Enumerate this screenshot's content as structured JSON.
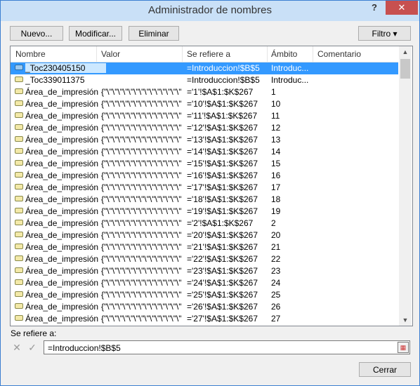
{
  "window": {
    "title": "Administrador de nombres",
    "help": "?",
    "close": "✕"
  },
  "toolbar": {
    "new_label": "Nuevo...",
    "edit_label": "Modificar...",
    "delete_label": "Eliminar",
    "filter_label": "Filtro ▾"
  },
  "columns": {
    "name": "Nombre",
    "value": "Valor",
    "refers_to": "Se refiere a",
    "scope": "Ámbito",
    "comment": "Comentario"
  },
  "rows": [
    {
      "name": "_Toc230405150",
      "value": "",
      "ref": "=Introduccion!$B$5",
      "scope": "Introduc...",
      "comment": "",
      "icon": "blue",
      "selected": true
    },
    {
      "name": "_Toc339011375",
      "value": "",
      "ref": "=Introduccion!$B$5",
      "scope": "Introduc...",
      "comment": "",
      "icon": "yellow",
      "selected": false
    },
    {
      "name": "Área_de_impresión",
      "value": "{\"\\\"\\\"\\\"\\\"\\\"\\\"\\\"\\\"\\\"\\\"\\\"\\\"\\\"\\\"\\\"\\\"\\\"\\\"...",
      "ref": "='1'!$A$1:$K$267",
      "scope": "1",
      "comment": "",
      "icon": "yellow",
      "selected": false
    },
    {
      "name": "Área_de_impresión",
      "value": "{\"\\\"\\\"\\\"\\\"\\\"\\\"\\\"\\\"\\\"\\\"\\\"\\\"\\\"\\\"\\\"\\\"\\\"\\\"...",
      "ref": "='10'!$A$1:$K$267",
      "scope": "10",
      "comment": "",
      "icon": "yellow",
      "selected": false
    },
    {
      "name": "Área_de_impresión",
      "value": "{\"\\\"\\\"\\\"\\\"\\\"\\\"\\\"\\\"\\\"\\\"\\\"\\\"\\\"\\\"\\\"\\\"\\\"\\\"...",
      "ref": "='11'!$A$1:$K$267",
      "scope": "11",
      "comment": "",
      "icon": "yellow",
      "selected": false
    },
    {
      "name": "Área_de_impresión",
      "value": "{\"\\\"\\\"\\\"\\\"\\\"\\\"\\\"\\\"\\\"\\\"\\\"\\\"\\\"\\\"\\\"\\\"\\\"\\\"...",
      "ref": "='12'!$A$1:$K$267",
      "scope": "12",
      "comment": "",
      "icon": "yellow",
      "selected": false
    },
    {
      "name": "Área_de_impresión",
      "value": "{\"\\\"\\\"\\\"\\\"\\\"\\\"\\\"\\\"\\\"\\\"\\\"\\\"\\\"\\\"\\\"\\\"\\\"\\\"...",
      "ref": "='13'!$A$1:$K$267",
      "scope": "13",
      "comment": "",
      "icon": "yellow",
      "selected": false
    },
    {
      "name": "Área_de_impresión",
      "value": "{\"\\\"\\\"\\\"\\\"\\\"\\\"\\\"\\\"\\\"\\\"\\\"\\\"\\\"\\\"\\\"\\\"\\\"\\\"...",
      "ref": "='14'!$A$1:$K$267",
      "scope": "14",
      "comment": "",
      "icon": "yellow",
      "selected": false
    },
    {
      "name": "Área_de_impresión",
      "value": "{\"\\\"\\\"\\\"\\\"\\\"\\\"\\\"\\\"\\\"\\\"\\\"\\\"\\\"\\\"\\\"\\\"\\\"\\\"...",
      "ref": "='15'!$A$1:$K$267",
      "scope": "15",
      "comment": "",
      "icon": "yellow",
      "selected": false
    },
    {
      "name": "Área_de_impresión",
      "value": "{\"\\\"\\\"\\\"\\\"\\\"\\\"\\\"\\\"\\\"\\\"\\\"\\\"\\\"\\\"\\\"\\\"\\\"\\\"...",
      "ref": "='16'!$A$1:$K$267",
      "scope": "16",
      "comment": "",
      "icon": "yellow",
      "selected": false
    },
    {
      "name": "Área_de_impresión",
      "value": "{\"\\\"\\\"\\\"\\\"\\\"\\\"\\\"\\\"\\\"\\\"\\\"\\\"\\\"\\\"\\\"\\\"\\\"\\\"...",
      "ref": "='17'!$A$1:$K$267",
      "scope": "17",
      "comment": "",
      "icon": "yellow",
      "selected": false
    },
    {
      "name": "Área_de_impresión",
      "value": "{\"\\\"\\\"\\\"\\\"\\\"\\\"\\\"\\\"\\\"\\\"\\\"\\\"\\\"\\\"\\\"\\\"\\\"\\\"...",
      "ref": "='18'!$A$1:$K$267",
      "scope": "18",
      "comment": "",
      "icon": "yellow",
      "selected": false
    },
    {
      "name": "Área_de_impresión",
      "value": "{\"\\\"\\\"\\\"\\\"\\\"\\\"\\\"\\\"\\\"\\\"\\\"\\\"\\\"\\\"\\\"\\\"\\\"\\\"...",
      "ref": "='19'!$A$1:$K$267",
      "scope": "19",
      "comment": "",
      "icon": "yellow",
      "selected": false
    },
    {
      "name": "Área_de_impresión",
      "value": "{\"\\\"\\\"\\\"\\\"\\\"\\\"\\\"\\\"\\\"\\\"\\\"\\\"\\\"\\\"\\\"\\\"\\\"\\\"...",
      "ref": "='2'!$A$1:$K$267",
      "scope": "2",
      "comment": "",
      "icon": "yellow",
      "selected": false
    },
    {
      "name": "Área_de_impresión",
      "value": "{\"\\\"\\\"\\\"\\\"\\\"\\\"\\\"\\\"\\\"\\\"\\\"\\\"\\\"\\\"\\\"\\\"\\\"\\\"...",
      "ref": "='20'!$A$1:$K$267",
      "scope": "20",
      "comment": "",
      "icon": "yellow",
      "selected": false
    },
    {
      "name": "Área_de_impresión",
      "value": "{\"\\\"\\\"\\\"\\\"\\\"\\\"\\\"\\\"\\\"\\\"\\\"\\\"\\\"\\\"\\\"\\\"\\\"\\\"...",
      "ref": "='21'!$A$1:$K$267",
      "scope": "21",
      "comment": "",
      "icon": "yellow",
      "selected": false
    },
    {
      "name": "Área_de_impresión",
      "value": "{\"\\\"\\\"\\\"\\\"\\\"\\\"\\\"\\\"\\\"\\\"\\\"\\\"\\\"\\\"\\\"\\\"\\\"\\\"...",
      "ref": "='22'!$A$1:$K$267",
      "scope": "22",
      "comment": "",
      "icon": "yellow",
      "selected": false
    },
    {
      "name": "Área_de_impresión",
      "value": "{\"\\\"\\\"\\\"\\\"\\\"\\\"\\\"\\\"\\\"\\\"\\\"\\\"\\\"\\\"\\\"\\\"\\\"\\\"...",
      "ref": "='23'!$A$1:$K$267",
      "scope": "23",
      "comment": "",
      "icon": "yellow",
      "selected": false
    },
    {
      "name": "Área_de_impresión",
      "value": "{\"\\\"\\\"\\\"\\\"\\\"\\\"\\\"\\\"\\\"\\\"\\\"\\\"\\\"\\\"\\\"\\\"\\\"\\\"...",
      "ref": "='24'!$A$1:$K$267",
      "scope": "24",
      "comment": "",
      "icon": "yellow",
      "selected": false
    },
    {
      "name": "Área_de_impresión",
      "value": "{\"\\\"\\\"\\\"\\\"\\\"\\\"\\\"\\\"\\\"\\\"\\\"\\\"\\\"\\\"\\\"\\\"\\\"\\\"...",
      "ref": "='25'!$A$1:$K$267",
      "scope": "25",
      "comment": "",
      "icon": "yellow",
      "selected": false
    },
    {
      "name": "Área_de_impresión",
      "value": "{\"\\\"\\\"\\\"\\\"\\\"\\\"\\\"\\\"\\\"\\\"\\\"\\\"\\\"\\\"\\\"\\\"\\\"\\\"...",
      "ref": "='26'!$A$1:$K$267",
      "scope": "26",
      "comment": "",
      "icon": "yellow",
      "selected": false
    },
    {
      "name": "Área_de_impresión",
      "value": "{\"\\\"\\\"\\\"\\\"\\\"\\\"\\\"\\\"\\\"\\\"\\\"\\\"\\\"\\\"\\\"\\\"\\\"\\\"...",
      "ref": "='27'!$A$1:$K$267",
      "scope": "27",
      "comment": "",
      "icon": "yellow",
      "selected": false
    }
  ],
  "refers_to": {
    "label": "Se refiere a:",
    "value": "=Introduccion!$B$5"
  },
  "footer": {
    "close_label": "Cerrar"
  },
  "colors": {
    "title_bar": "#c9e0f7",
    "selection": "#3399ff",
    "close_button": "#c75050"
  }
}
